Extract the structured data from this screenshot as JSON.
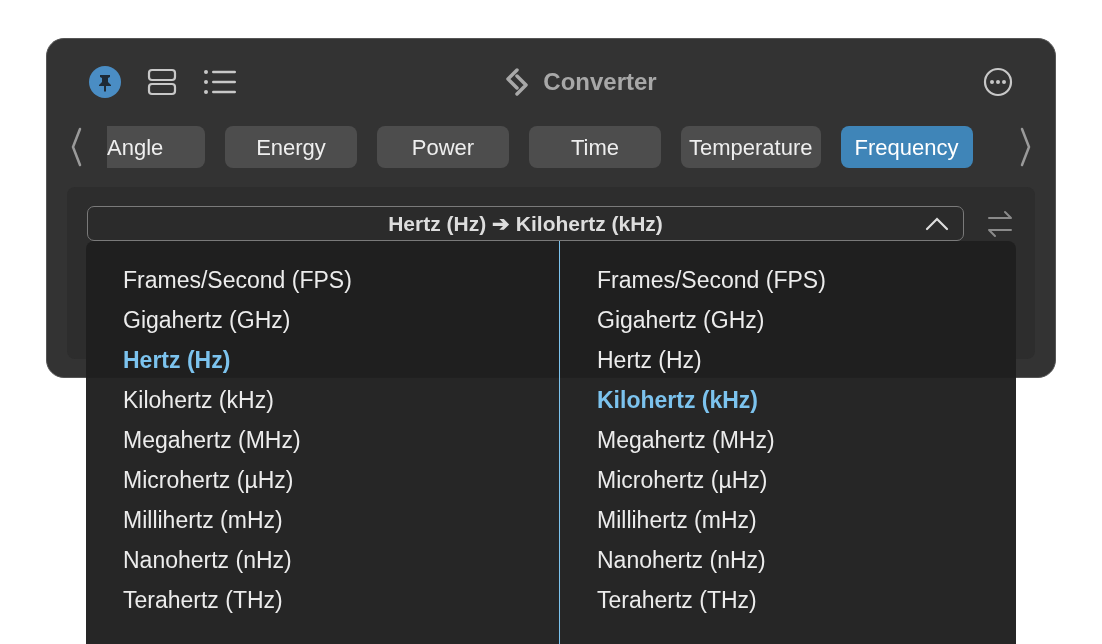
{
  "window": {
    "title": "Converter"
  },
  "tabs": [
    {
      "label": "Angle",
      "selected": false
    },
    {
      "label": "Energy",
      "selected": false
    },
    {
      "label": "Power",
      "selected": false
    },
    {
      "label": "Time",
      "selected": false
    },
    {
      "label": "Temperature",
      "selected": false
    },
    {
      "label": "Frequency",
      "selected": true
    }
  ],
  "conversion_selector": {
    "value": "Hertz (Hz) ➔ Kilohertz (kHz)",
    "expanded": true
  },
  "from_units": [
    {
      "label": "Frames/Second (FPS)",
      "selected": false
    },
    {
      "label": "Gigahertz (GHz)",
      "selected": false
    },
    {
      "label": "Hertz (Hz)",
      "selected": true
    },
    {
      "label": "Kilohertz (kHz)",
      "selected": false
    },
    {
      "label": "Megahertz (MHz)",
      "selected": false
    },
    {
      "label": "Microhertz (µHz)",
      "selected": false
    },
    {
      "label": "Millihertz (mHz)",
      "selected": false
    },
    {
      "label": "Nanohertz (nHz)",
      "selected": false
    },
    {
      "label": "Terahertz (THz)",
      "selected": false
    }
  ],
  "to_units": [
    {
      "label": "Frames/Second (FPS)",
      "selected": false
    },
    {
      "label": "Gigahertz (GHz)",
      "selected": false
    },
    {
      "label": "Hertz (Hz)",
      "selected": false
    },
    {
      "label": "Kilohertz (kHz)",
      "selected": true
    },
    {
      "label": "Megahertz (MHz)",
      "selected": false
    },
    {
      "label": "Microhertz (µHz)",
      "selected": false
    },
    {
      "label": "Millihertz (mHz)",
      "selected": false
    },
    {
      "label": "Nanohertz (nHz)",
      "selected": false
    },
    {
      "label": "Terahertz (THz)",
      "selected": false
    }
  ]
}
